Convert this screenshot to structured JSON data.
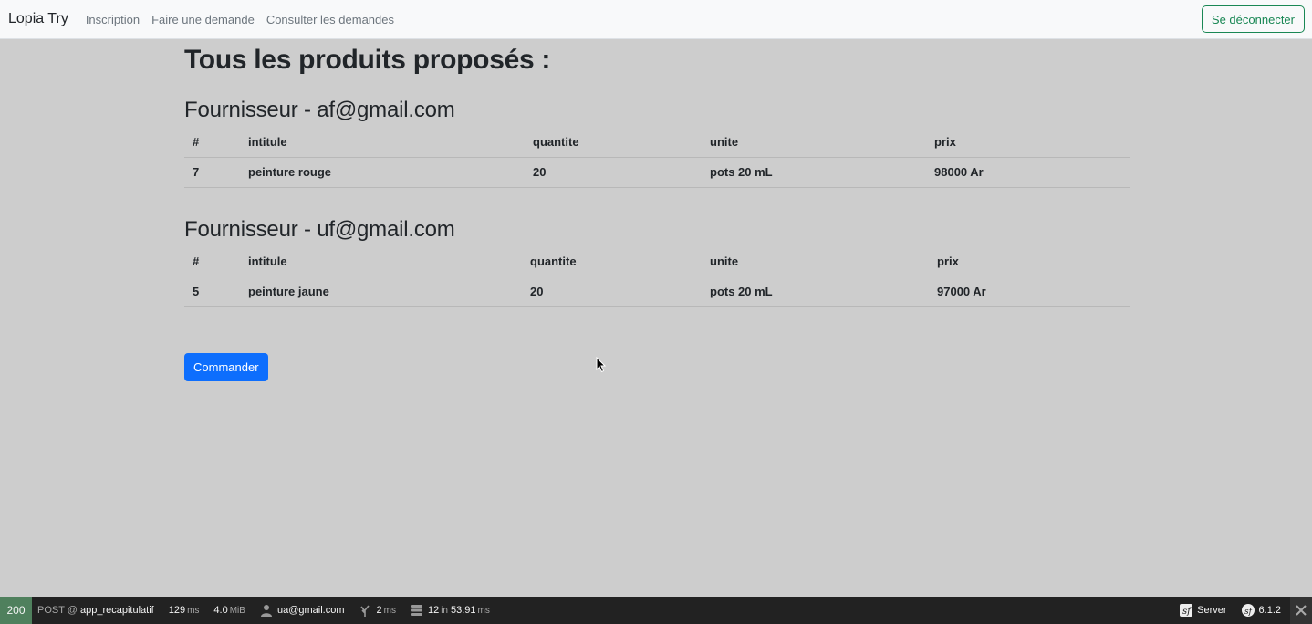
{
  "navbar": {
    "brand": "Lopia Try",
    "links": [
      "Inscription",
      "Faire une demande",
      "Consulter les demandes"
    ],
    "logout_label": "Se déconnecter"
  },
  "main": {
    "title": "Tous les produits proposés :",
    "suppliers": [
      {
        "title": "Fournisseur - af@gmail.com",
        "headers": [
          "#",
          "intitule",
          "quantite",
          "unite",
          "prix"
        ],
        "rows": [
          [
            "7",
            "peinture rouge",
            "20",
            "pots 20 mL",
            "98000 Ar"
          ]
        ]
      },
      {
        "title": "Fournisseur - uf@gmail.com",
        "headers": [
          "#",
          "intitule",
          "quantite",
          "unite",
          "prix"
        ],
        "rows": [
          [
            "5",
            "peinture jaune",
            "20",
            "pots 20 mL",
            "97000 Ar"
          ]
        ]
      }
    ],
    "order_label": "Commander"
  },
  "toolbar": {
    "status": "200",
    "method": "POST @",
    "route": "app_recapitulatif",
    "time": "129",
    "time_unit": "ms",
    "memory": "4.0",
    "memory_unit": "MiB",
    "user": "ua@gmail.com",
    "twig_time": "2",
    "twig_unit": "ms",
    "db_queries": "12",
    "db_in": "in",
    "db_time": "53.91",
    "db_unit": "ms",
    "server_label": "Server",
    "version": "6.1.2"
  },
  "colors": {
    "background": "#cdcdcd",
    "primary": "#0d6efd",
    "success": "#198754",
    "toolbar_bg": "#222222",
    "status_bg": "#4f805d"
  },
  "icons": [
    "user-icon",
    "twig-icon",
    "database-icon",
    "symfony-icon",
    "close-icon",
    "mouse-cursor-icon"
  ]
}
